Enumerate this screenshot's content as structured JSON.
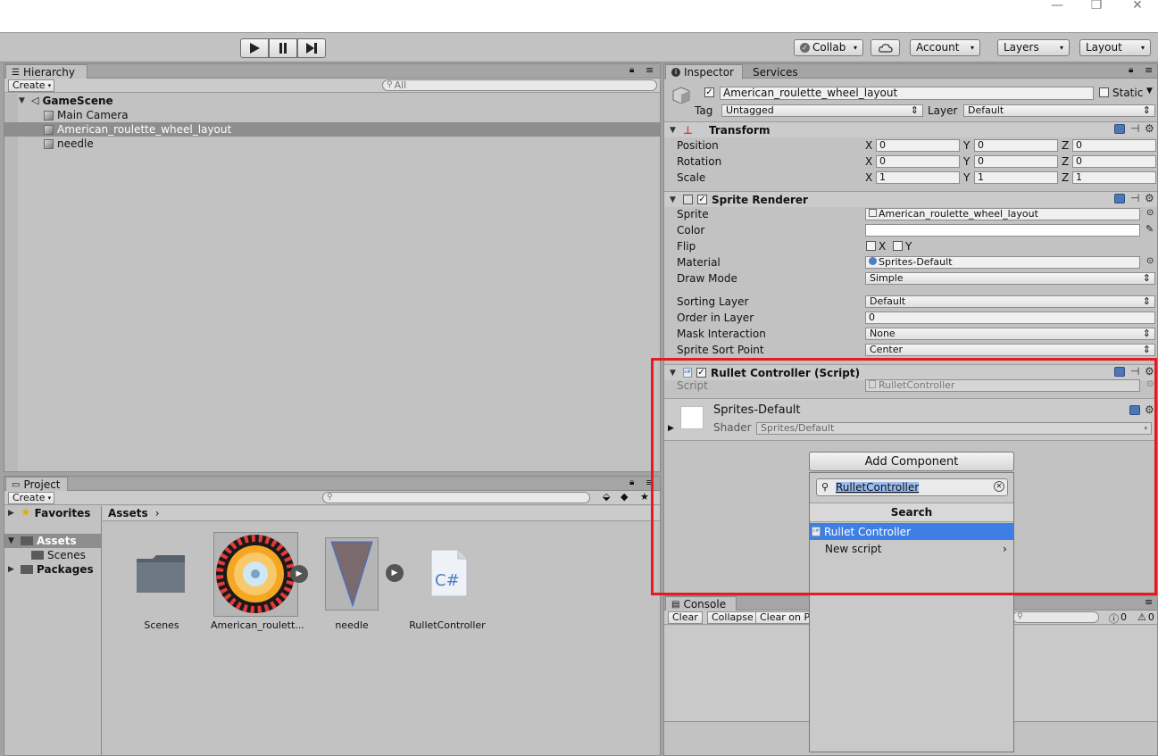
{
  "window": {
    "minimize": "—",
    "restore": "❐",
    "close": "✕"
  },
  "toolbar": {
    "play_icon": "play-icon",
    "pause_icon": "pause-icon",
    "step_icon": "step-icon",
    "collab": "Collab",
    "account": "Account",
    "layers": "Layers",
    "layout": "Layout"
  },
  "hierarchy": {
    "tab": "Hierarchy",
    "create": "Create",
    "search_placeholder": "All",
    "scene": "GameScene",
    "items": [
      "Main Camera",
      "American_roulette_wheel_layout",
      "needle"
    ],
    "selected_index": 1
  },
  "project": {
    "tab": "Project",
    "create": "Create",
    "tree": {
      "favorites": "Favorites",
      "assets": "Assets",
      "scenes": "Scenes",
      "packages": "Packages"
    },
    "breadcrumb": "Assets",
    "assets": [
      {
        "name": "Scenes",
        "kind": "folder"
      },
      {
        "name": "American_roulett...",
        "kind": "sprite-wheel"
      },
      {
        "name": "needle",
        "kind": "sprite-needle"
      },
      {
        "name": "RulletController",
        "kind": "script",
        "glyph": "C#"
      }
    ]
  },
  "inspector": {
    "tab": "Inspector",
    "tab2": "Services",
    "object_name": "American_roulette_wheel_layout",
    "static_label": "Static",
    "tag_label": "Tag",
    "tag_value": "Untagged",
    "layer_label": "Layer",
    "layer_value": "Default",
    "transform": {
      "title": "Transform",
      "rows": [
        {
          "label": "Position",
          "x": "0",
          "y": "0",
          "z": "0"
        },
        {
          "label": "Rotation",
          "x": "0",
          "y": "0",
          "z": "0"
        },
        {
          "label": "Scale",
          "x": "1",
          "y": "1",
          "z": "1"
        }
      ],
      "axis_x": "X",
      "axis_y": "Y",
      "axis_z": "Z"
    },
    "sprite_renderer": {
      "title": "Sprite Renderer",
      "sprite_label": "Sprite",
      "sprite_value": "American_roulette_wheel_layout",
      "color_label": "Color",
      "flip_label": "Flip",
      "flip_x": "X",
      "flip_y": "Y",
      "material_label": "Material",
      "material_value": "Sprites-Default",
      "draw_mode_label": "Draw Mode",
      "draw_mode_value": "Simple",
      "sorting_layer_label": "Sorting Layer",
      "sorting_layer_value": "Default",
      "order_label": "Order in Layer",
      "order_value": "0",
      "mask_label": "Mask Interaction",
      "mask_value": "None",
      "sort_point_label": "Sprite Sort Point",
      "sort_point_value": "Center"
    },
    "script_component": {
      "title": "Rullet Controller (Script)",
      "script_label": "Script",
      "script_value": "RulletController"
    },
    "material": {
      "name": "Sprites-Default",
      "shader_label": "Shader",
      "shader_value": "Sprites/Default"
    },
    "add_component": "Add Component"
  },
  "popup": {
    "search_value": "RulletController",
    "header": "Search",
    "results": [
      "Rullet Controller"
    ],
    "new_script": "New script"
  },
  "console": {
    "tab": "Console",
    "clear": "Clear",
    "collapse": "Collapse",
    "clear_on_play": "Clear on Pla",
    "count_warn": "0",
    "count_err": "0"
  },
  "colors": {
    "highlight": "#e41b23",
    "selection": "#3d7fe5",
    "panel": "#c2c2c2"
  }
}
